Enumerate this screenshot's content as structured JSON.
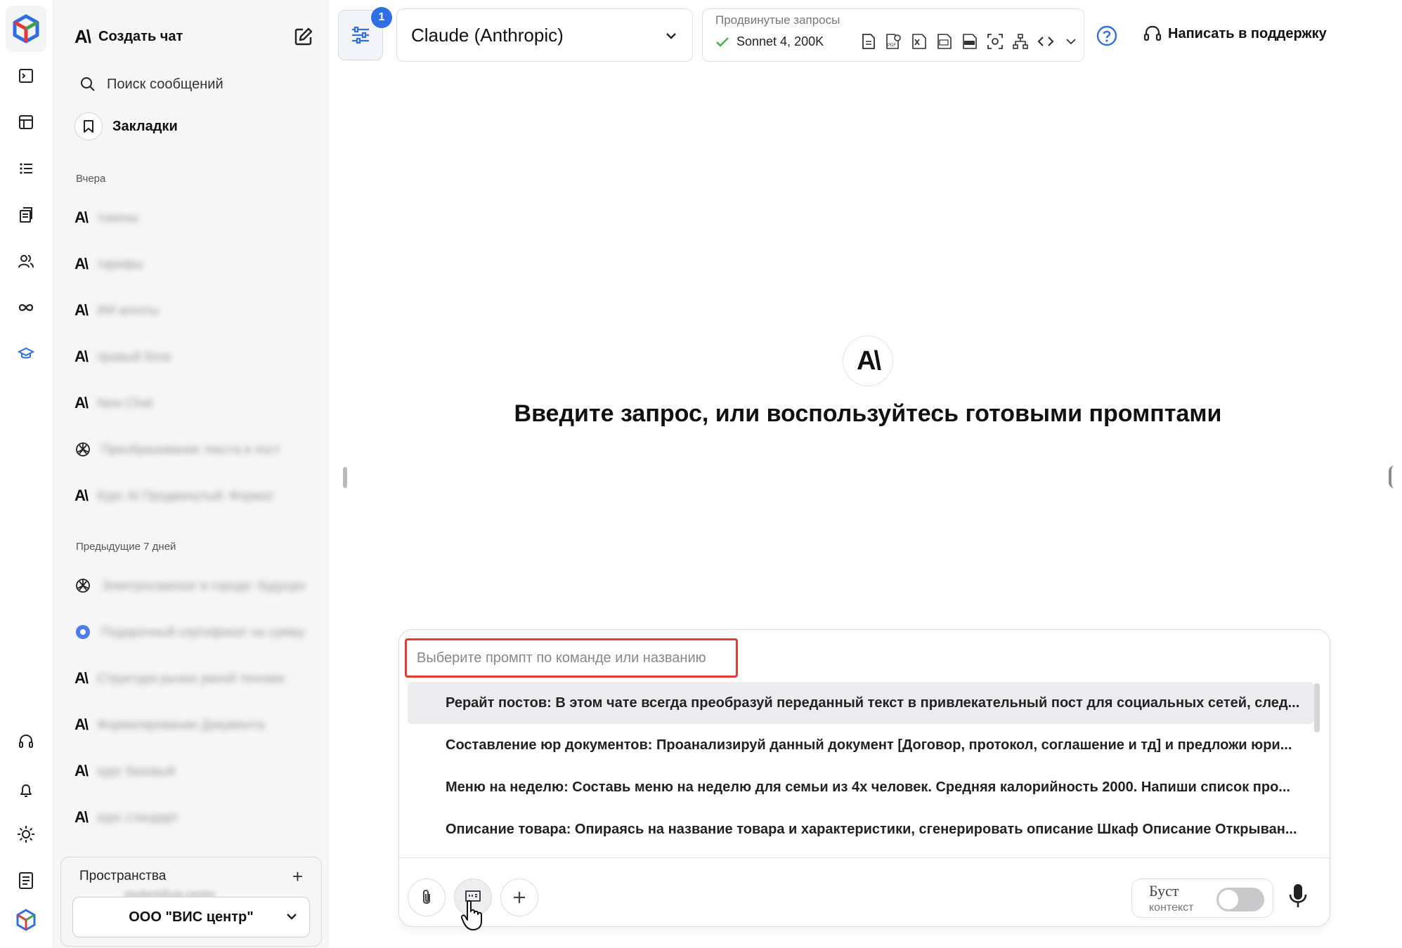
{
  "sidebar": {
    "new_chat_label": "Создать чат",
    "search_label": "Поиск сообщений",
    "bookmarks_label": "Закладки",
    "groups": [
      {
        "label": "Вчера"
      },
      {
        "label": "Предыдущие 7 дней"
      }
    ],
    "history_yesterday": [
      {
        "icon": "anthropic-icon",
        "title": "токены"
      },
      {
        "icon": "anthropic-icon",
        "title": "тарифы"
      },
      {
        "icon": "anthropic-icon",
        "title": "ИИ агенты"
      },
      {
        "icon": "anthropic-icon",
        "title": "правый блок"
      },
      {
        "icon": "anthropic-icon",
        "title": "New Chat"
      },
      {
        "icon": "openai-icon",
        "title": "Преобразование текста в пост"
      },
      {
        "icon": "anthropic-icon",
        "title": "Курс AI Продвинутый: Формат"
      }
    ],
    "history_week": [
      {
        "icon": "openai-icon",
        "title": "Электросамокат в городе: будущее"
      },
      {
        "icon": "blue-circle-icon",
        "title": "Подарочный сертификат на сумму"
      },
      {
        "icon": "anthropic-icon",
        "title": "Структура рынка умной техники"
      },
      {
        "icon": "anthropic-icon",
        "title": "Форматирование Документа"
      },
      {
        "icon": "anthropic-icon",
        "title": "курс базовый"
      },
      {
        "icon": "anthropic-icon",
        "title": "курс стандарт"
      }
    ],
    "spaces": {
      "label": "Пространства",
      "add_symbol": "+",
      "subtitle": "student@vis-center",
      "org": "ООО \"ВИС центр\""
    }
  },
  "topbar": {
    "filter_badge": "1",
    "model_name": "Claude (Anthropic)",
    "advanced_caption": "Продвинутые запросы",
    "advanced_model": "Sonnet 4, 200K",
    "support_label": "Написать в поддержку"
  },
  "main": {
    "headline": "Введите запрос, или воспользуйтесь готовыми промптами"
  },
  "composer": {
    "prompt_placeholder": "Выберите промпт по команде или названию",
    "prompts": [
      "Рерайт постов: В этом чате всегда преобразуй переданный текст в привлекательный пост для социальных сетей, след...",
      "Составление юр документов: Проанализируй данный документ [Договор, протокол, соглашение и тд] и предложи юри...",
      "Меню на неделю: Составь меню на неделю для семьи из 4х человек. Средняя калорийность 2000. Напиши список про...",
      "Описание товара: Опираясь на название товара и характеристики, сгенерировать описание Шкаф Описание Открыван..."
    ],
    "active_prompt_index": 0,
    "boost_label": "Буст",
    "boost_sublabel": "контекст",
    "boost_enabled": false
  },
  "colors": {
    "accent_blue": "#2f6fe4",
    "highlight_red": "#e53935",
    "sidebar_bg": "#f6f6f7"
  }
}
